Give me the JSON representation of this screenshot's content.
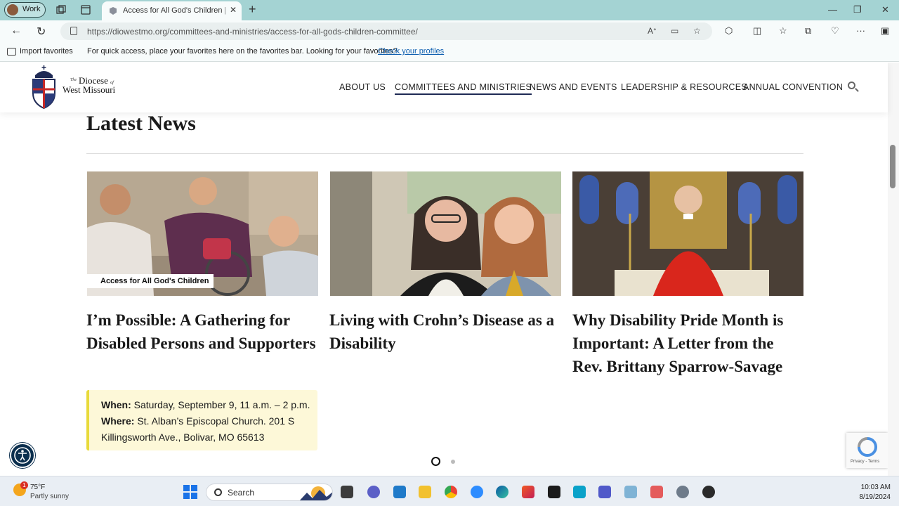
{
  "browser": {
    "profile_label": "Work",
    "tab_title": "Access for All God's Children | Th",
    "url_host": "https://diowestmo.org",
    "url_path": "/committees-and-ministries/access-for-all-gods-children-committee/",
    "favbar": {
      "import_label": "Import favorites",
      "message": "For quick access, place your favorites here on the favorites bar. Looking for your favorites?",
      "link_label": "Check your profiles"
    }
  },
  "site": {
    "logo": {
      "the": "The",
      "line1": "Diocese",
      "of": "of",
      "line2": "West Missouri"
    },
    "nav": [
      {
        "label": "ABOUT US"
      },
      {
        "label": "COMMITTEES AND MINISTRIES",
        "active": true
      },
      {
        "label": "NEWS AND EVENTS"
      },
      {
        "label": "LEADERSHIP & RESOURCES"
      },
      {
        "label": "ANNUAL CONVENTION"
      }
    ]
  },
  "main": {
    "section_title": "Latest News",
    "cards": [
      {
        "tag": "Access for All God's Children",
        "title": "I’m Possible: A Gathering for Disabled Persons and Supporters",
        "event": {
          "when_label": "When:",
          "when_value": "Saturday, September 9, 11 a.m. – 2 p.m.",
          "where_label": "Where:",
          "where_value": "St. Alban’s Episcopal Church. 201 S Killingsworth Ave., Bolivar, MO 65613"
        }
      },
      {
        "title": "Living with Crohn’s Disease as a Disability"
      },
      {
        "title": "Why Disability Pride Month is Important: A Letter from the Rev. Brittany Sparrow-Savage"
      }
    ],
    "pagination_active": 1
  },
  "recaptcha_label": "Privacy - Terms",
  "taskbar": {
    "weather_temp": "75°F",
    "weather_desc": "Partly sunny",
    "weather_badge": "1",
    "search_label": "Search",
    "time": "10:03 AM",
    "date": "8/19/2024"
  },
  "colors": {
    "accent": "#1f2a55",
    "event_bg": "#fdf8d8",
    "event_border": "#e8da3a",
    "tabbar": "#a4d3d3"
  }
}
